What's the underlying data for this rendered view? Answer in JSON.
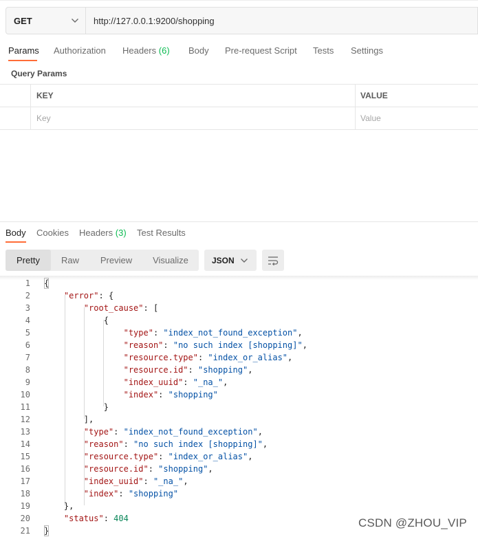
{
  "request": {
    "method": "GET",
    "url": "http://127.0.0.1:9200/shopping"
  },
  "request_tabs": {
    "params": "Params",
    "authorization": "Authorization",
    "headers_label": "Headers",
    "headers_count": "(6)",
    "body": "Body",
    "prerequest": "Pre-request Script",
    "tests": "Tests",
    "settings": "Settings"
  },
  "query_params": {
    "title": "Query Params",
    "col_key": "KEY",
    "col_value": "VALUE",
    "key_placeholder": "Key",
    "value_placeholder": "Value"
  },
  "response_tabs": {
    "body": "Body",
    "cookies": "Cookies",
    "headers_label": "Headers",
    "headers_count": "(3)",
    "test_results": "Test Results"
  },
  "view_modes": {
    "pretty": "Pretty",
    "raw": "Raw",
    "preview": "Preview",
    "visualize": "Visualize"
  },
  "format": "JSON",
  "code_lines": {
    "l1": "{",
    "l2": {
      "indent": "    ",
      "key": "\"error\"",
      "rest": ": {"
    },
    "l3": {
      "indent": "        ",
      "key": "\"root_cause\"",
      "rest": ": ["
    },
    "l4": "            {",
    "l5": {
      "indent": "                ",
      "key": "\"type\"",
      "sep": ": ",
      "val": "\"index_not_found_exception\"",
      "end": ","
    },
    "l6": {
      "indent": "                ",
      "key": "\"reason\"",
      "sep": ": ",
      "val": "\"no such index [shopping]\"",
      "end": ","
    },
    "l7": {
      "indent": "                ",
      "key": "\"resource.type\"",
      "sep": ": ",
      "val": "\"index_or_alias\"",
      "end": ","
    },
    "l8": {
      "indent": "                ",
      "key": "\"resource.id\"",
      "sep": ": ",
      "val": "\"shopping\"",
      "end": ","
    },
    "l9": {
      "indent": "                ",
      "key": "\"index_uuid\"",
      "sep": ": ",
      "val": "\"_na_\"",
      "end": ","
    },
    "l10": {
      "indent": "                ",
      "key": "\"index\"",
      "sep": ": ",
      "val": "\"shopping\"",
      "end": ""
    },
    "l11": "            }",
    "l12": "        ],",
    "l13": {
      "indent": "        ",
      "key": "\"type\"",
      "sep": ": ",
      "val": "\"index_not_found_exception\"",
      "end": ","
    },
    "l14": {
      "indent": "        ",
      "key": "\"reason\"",
      "sep": ": ",
      "val": "\"no such index [shopping]\"",
      "end": ","
    },
    "l15": {
      "indent": "        ",
      "key": "\"resource.type\"",
      "sep": ": ",
      "val": "\"index_or_alias\"",
      "end": ","
    },
    "l16": {
      "indent": "        ",
      "key": "\"resource.id\"",
      "sep": ": ",
      "val": "\"shopping\"",
      "end": ","
    },
    "l17": {
      "indent": "        ",
      "key": "\"index_uuid\"",
      "sep": ": ",
      "val": "\"_na_\"",
      "end": ","
    },
    "l18": {
      "indent": "        ",
      "key": "\"index\"",
      "sep": ": ",
      "val": "\"shopping\"",
      "end": ""
    },
    "l19": "    },",
    "l20": {
      "indent": "    ",
      "key": "\"status\"",
      "sep": ": ",
      "val": "404",
      "end": ""
    },
    "l21": "}"
  },
  "line_numbers": [
    "1",
    "2",
    "3",
    "4",
    "5",
    "6",
    "7",
    "8",
    "9",
    "10",
    "11",
    "12",
    "13",
    "14",
    "15",
    "16",
    "17",
    "18",
    "19",
    "20",
    "21"
  ],
  "watermark": "CSDN @ZHOU_VIP",
  "colors": {
    "accent": "#ff6c37",
    "count_green": "#0cbb52",
    "json_key": "#a31515",
    "json_string": "#0451a5",
    "json_number": "#098658"
  },
  "icons": {
    "method_dropdown": "chevron-down-icon",
    "format_dropdown": "chevron-down-icon",
    "wrap": "text-wrap-icon"
  }
}
